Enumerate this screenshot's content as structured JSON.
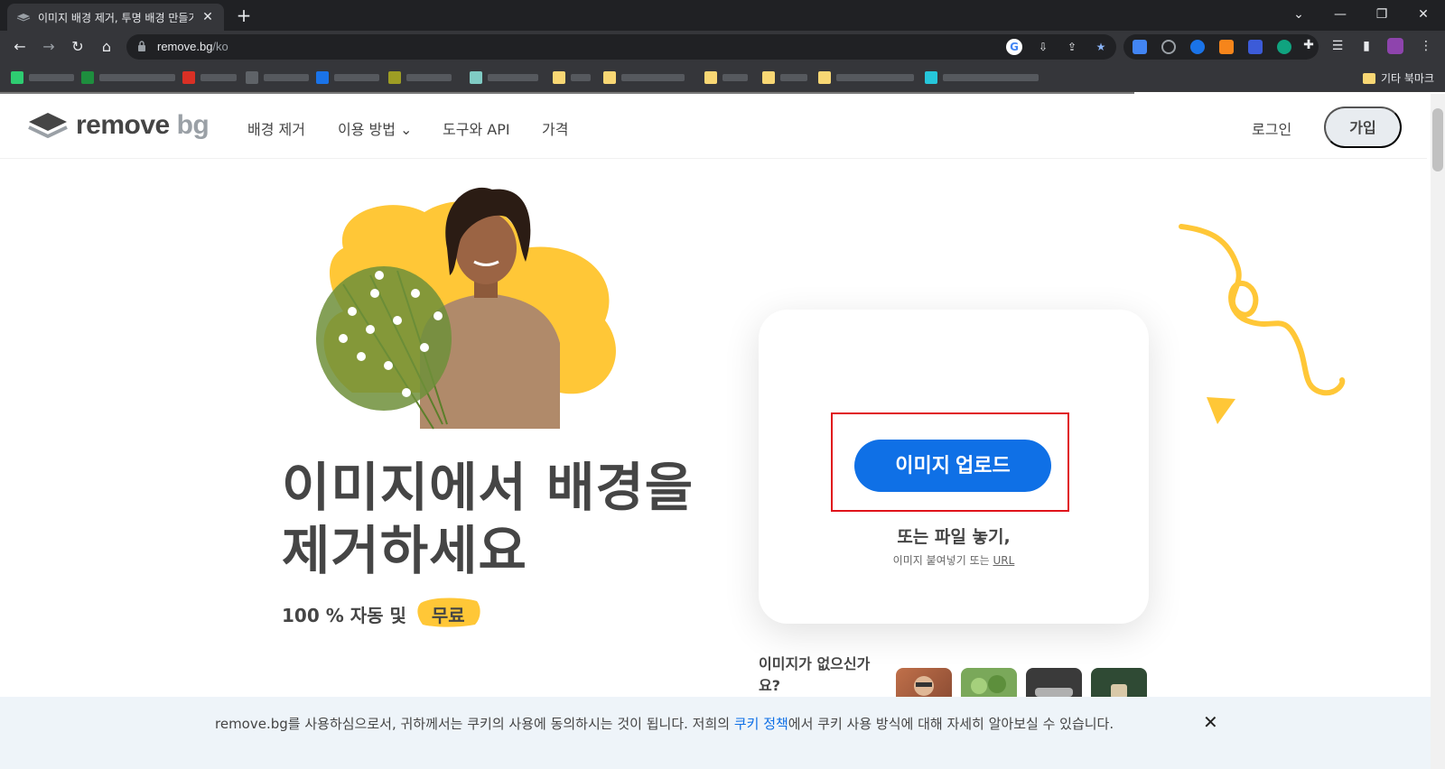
{
  "browser": {
    "tab_title": "이미지 배경 제거, 투명 배경 만들기",
    "tab_close": "✕",
    "new_tab": "+",
    "url_host": "remove.bg",
    "url_path": "/ko",
    "other_bookmarks": "기타 북마크",
    "window_controls": {
      "minimize": "—",
      "restore": "❐",
      "close": "✕",
      "dropdown": "⌄"
    }
  },
  "header": {
    "logo_main": "remove",
    "logo_bg": "bg",
    "nav": [
      {
        "label": "배경 제거"
      },
      {
        "label": "이용 방법"
      },
      {
        "label": "도구와 API"
      },
      {
        "label": "가격"
      }
    ],
    "login": "로그인",
    "signup": "가입"
  },
  "hero": {
    "headline_line1": "이미지에서 배경을",
    "headline_line2": "제거하세요",
    "subline_prefix": "100 % 자동 및",
    "subline_badge": "무료"
  },
  "upload": {
    "button_label": "이미지 업로드",
    "drop_text": "또는 파일 놓기,",
    "paste_text": "이미지 붙여넣기 또는",
    "url_link": "URL"
  },
  "samples": {
    "no_image": "이미지가 없으신가요?"
  },
  "cookie": {
    "text_before": "remove.bg를 사용하심으로서, 귀하께서는 쿠키의 사용에 동의하시는 것이 됩니다. 저희의 ",
    "link": "쿠키 정책",
    "text_after": "에서 쿠키 사용 방식에 대해 자세히 알아보실 수 있습니다.",
    "close": "✕"
  },
  "colors": {
    "accent": "#0f70e6",
    "yellow": "#ffc737",
    "highlight": "#e0131b"
  }
}
